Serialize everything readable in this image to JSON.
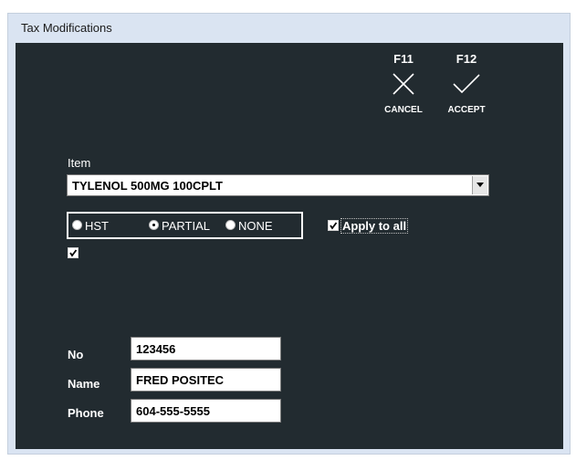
{
  "window": {
    "title": "Tax Modifications"
  },
  "toolbar": {
    "cancel": {
      "key": "F11",
      "label": "CANCEL"
    },
    "accept": {
      "key": "F12",
      "label": "ACCEPT"
    }
  },
  "item": {
    "label": "Item",
    "selected": "TYLENOL 500MG 100CPLT"
  },
  "tax": {
    "options": [
      {
        "label": "HST",
        "selected": false
      },
      {
        "label": "PARTIAL",
        "selected": true
      },
      {
        "label": "NONE",
        "selected": false
      }
    ],
    "apply_to_all": {
      "label": "Apply to all",
      "checked": true
    },
    "extra_checkbox_checked": true
  },
  "customer": {
    "no": {
      "label": "No",
      "value": "123456"
    },
    "name": {
      "label": "Name",
      "value": "FRED POSITEC"
    },
    "phone": {
      "label": "Phone",
      "value": "604-555-5555"
    }
  },
  "colors": {
    "background": "#222b30",
    "titlebar": "#dae4f2",
    "text": "#ffffff"
  }
}
